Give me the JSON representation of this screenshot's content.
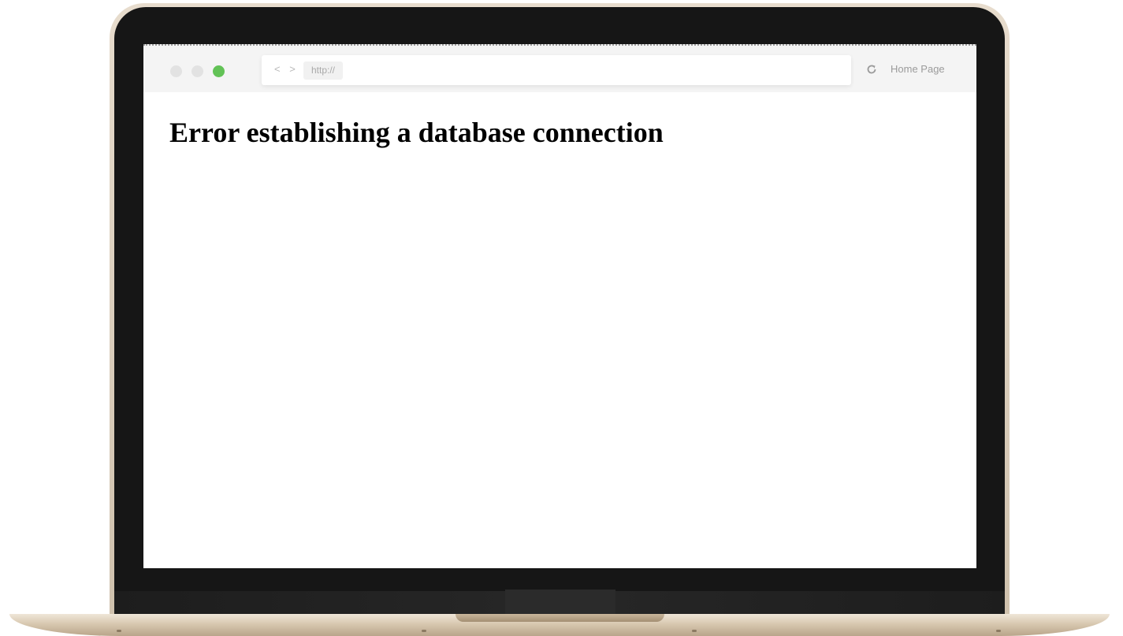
{
  "browser": {
    "nav_arrows": "< >",
    "url": "http://",
    "home_label": "Home Page",
    "traffic_light_colors": [
      "#e2e2e2",
      "#e2e2e2",
      "#62c256"
    ],
    "icons": [
      "back-icon",
      "forward-icon",
      "reload-icon"
    ]
  },
  "page": {
    "title": "Error establishing a database connection"
  }
}
